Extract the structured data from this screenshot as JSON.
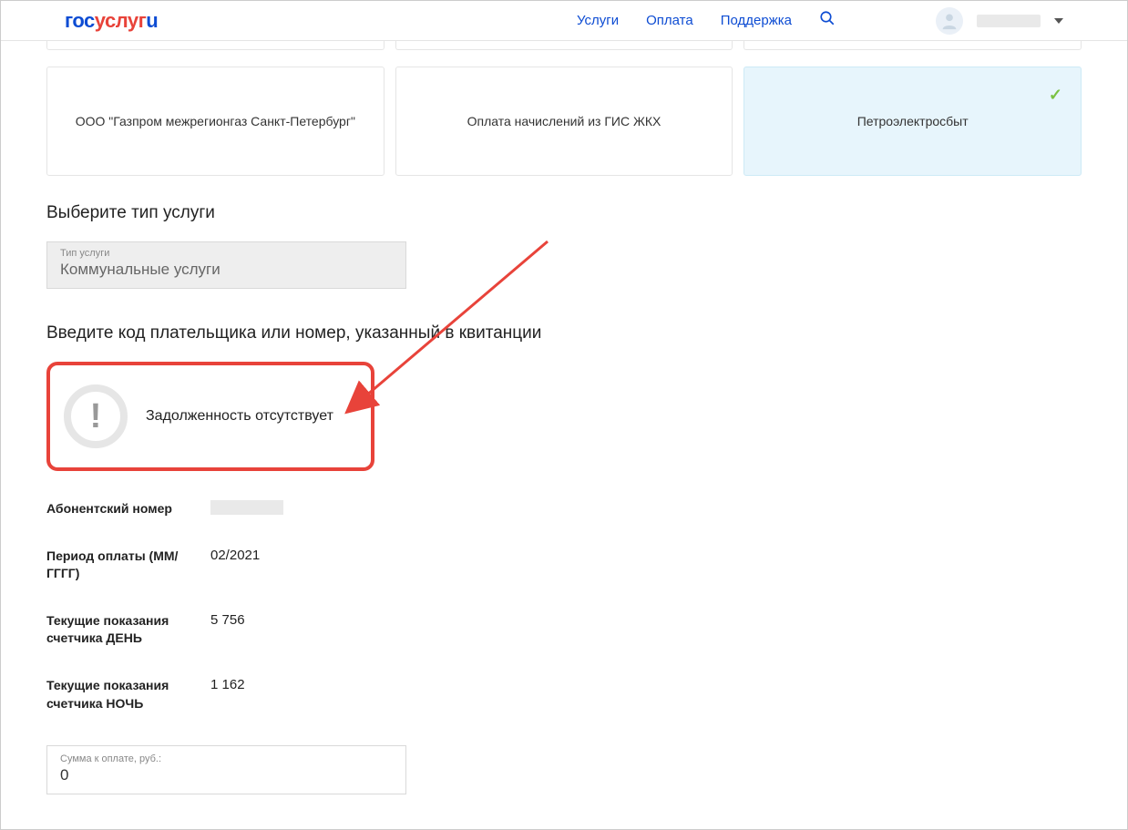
{
  "header": {
    "logo": {
      "p1": "гос",
      "p2": "услуг",
      "p3": "u"
    },
    "nav": {
      "services": "Услуги",
      "payment": "Оплата",
      "support": "Поддержка"
    }
  },
  "providers": {
    "gazprom": "ООО \"Газпром межрегионгаз Санкт-Петербург\"",
    "gis": "Оплата начислений из ГИС ЖКХ",
    "petro": "Петроэлектросбыт"
  },
  "sections": {
    "choose_type": "Выберите тип услуги",
    "enter_code": "Введите код плательщика или номер, указанный в квитанции"
  },
  "service_type": {
    "label": "Тип услуги",
    "value": "Коммунальные услуги"
  },
  "alert": {
    "text": "Задолженность отсутствует",
    "mark": "!"
  },
  "info": {
    "subscriber_label": "Абонентский номер",
    "period_label": "Период оплаты (ММ/ГГГГ)",
    "period_value": "02/2021",
    "day_label": "Текущие показания счетчика ДЕНЬ",
    "day_value": "5 756",
    "night_label": "Текущие показания счетчика НОЧЬ",
    "night_value": "1 162"
  },
  "amount": {
    "label": "Сумма к оплате, руб.:",
    "value": "0"
  }
}
